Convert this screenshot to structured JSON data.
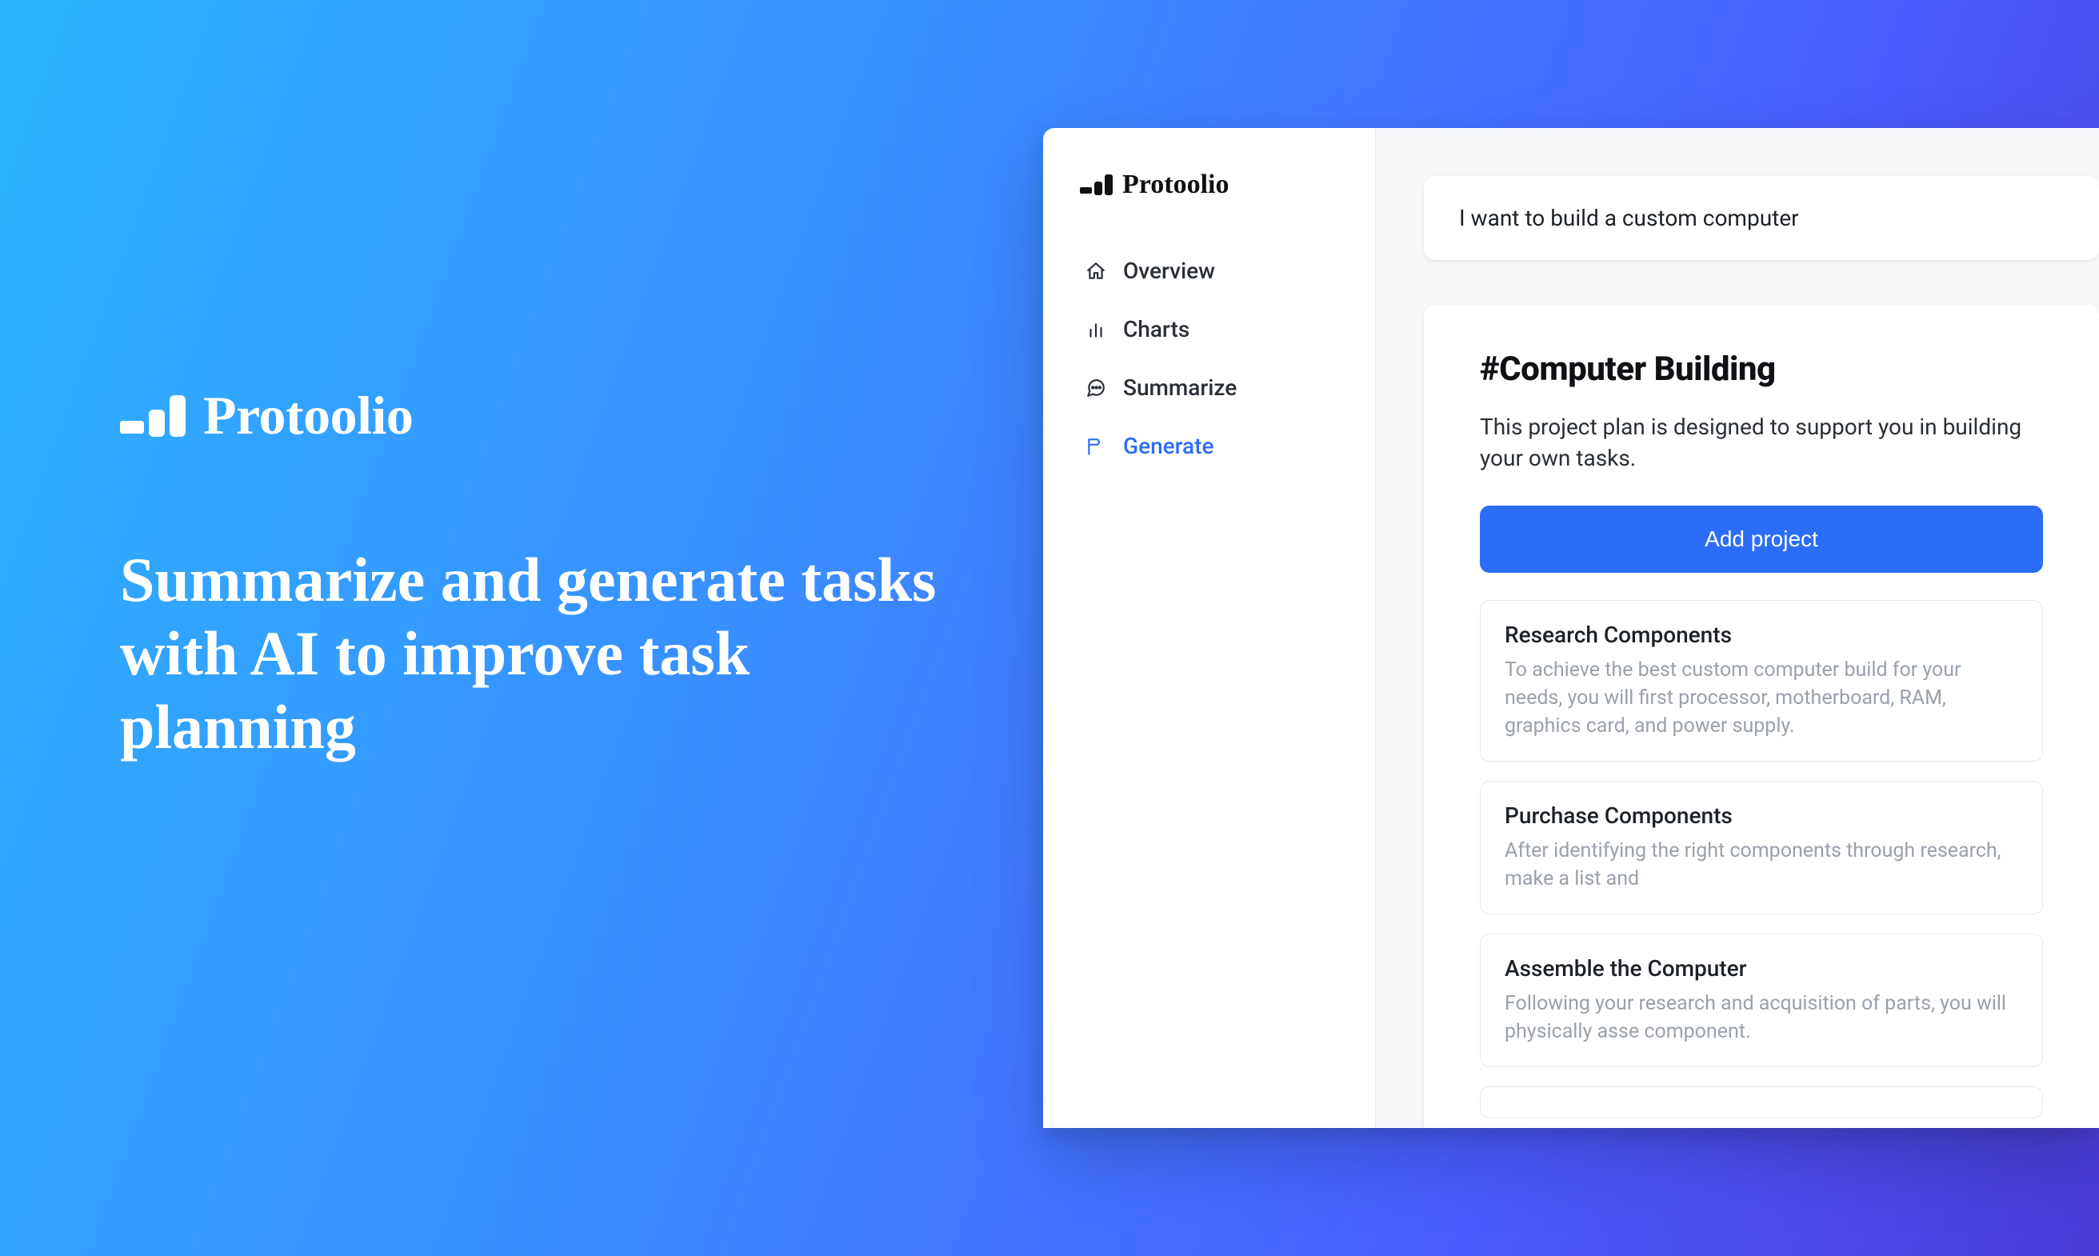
{
  "hero": {
    "brand": "Protoolio",
    "headline": "Summarize and generate tasks with AI to improve task planning"
  },
  "app": {
    "brand": "Protoolio",
    "nav": [
      {
        "label": "Overview",
        "name": "sidebar-item-overview",
        "icon": "home-icon",
        "active": false
      },
      {
        "label": "Charts",
        "name": "sidebar-item-charts",
        "icon": "chart-icon",
        "active": false
      },
      {
        "label": "Summarize",
        "name": "sidebar-item-summarize",
        "icon": "chat-icon",
        "active": false
      },
      {
        "label": "Generate",
        "name": "sidebar-item-generate",
        "icon": "flag-icon",
        "active": true
      }
    ],
    "prompt": "I want to build a custom computer",
    "result": {
      "title": "#Computer Building",
      "description": "This project plan is designed to support you in building your own tasks.",
      "add_button": "Add project",
      "tasks": [
        {
          "title": "Research Components",
          "description": "To achieve the best custom computer build for your needs, you will first processor, motherboard, RAM, graphics card, and power supply."
        },
        {
          "title": "Purchase Components",
          "description": "After identifying the right components through research, make a list and"
        },
        {
          "title": "Assemble the Computer",
          "description": "Following your research and acquisition of parts, you will physically asse component."
        }
      ]
    }
  }
}
